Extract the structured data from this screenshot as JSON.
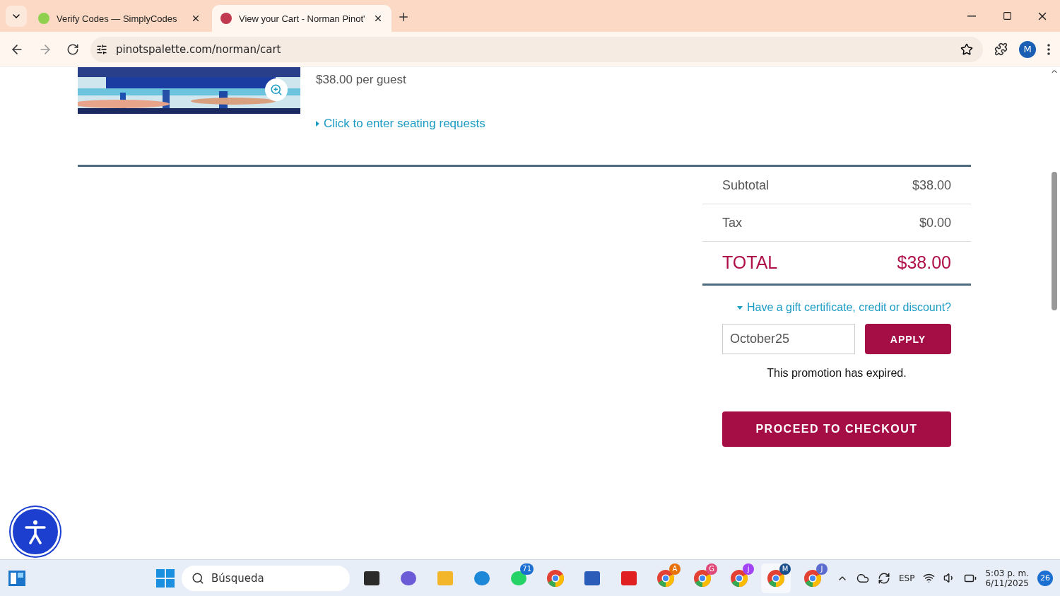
{
  "browser": {
    "tabs": [
      {
        "title": "Verify Codes — SimplyCodes",
        "selected": false
      },
      {
        "title": "View your Cart - Norman Pinot'",
        "selected": true
      }
    ],
    "url": "pinotspalette.com/norman/cart",
    "profile": "M"
  },
  "item": {
    "price": "$38.00 per guest",
    "seating_link": "Click to enter seating requests"
  },
  "summary": {
    "rows": [
      {
        "label": "Subtotal",
        "value": "$38.00",
        "kind": "line"
      },
      {
        "label": "Tax",
        "value": "$0.00",
        "kind": "line"
      },
      {
        "label": "TOTAL",
        "value": "$38.00",
        "kind": "total"
      }
    ],
    "discount_toggle": "Have a gift certificate, credit or discount?",
    "discount_expanded": true,
    "code": "October25",
    "apply": "APPLY",
    "message": "This promotion has expired.",
    "checkout": "PROCEED TO CHECKOUT"
  },
  "taskbar": {
    "search": "Búsqueda",
    "apps": [
      {
        "kind": "files"
      },
      {
        "kind": "teams"
      },
      {
        "kind": "folder"
      },
      {
        "kind": "edge"
      },
      {
        "kind": "whatsapp",
        "badge": "71"
      },
      {
        "kind": "chrome"
      },
      {
        "kind": "word"
      },
      {
        "kind": "wps"
      },
      {
        "kind": "chrome",
        "badge": "A",
        "color": "#e8710a"
      },
      {
        "kind": "chrome",
        "badge": "G",
        "color": "#e04a7a"
      },
      {
        "kind": "chrome",
        "badge": "j",
        "color": "#a142f4"
      },
      {
        "kind": "chrome",
        "badge": "M",
        "color": "#1a4f8c",
        "selected": true
      },
      {
        "kind": "chrome",
        "badge": "J",
        "color": "#5b6bd0"
      }
    ],
    "language": "ESP",
    "time": "5:03 p. m.",
    "date": "6/11/2025",
    "notifications": "26"
  }
}
